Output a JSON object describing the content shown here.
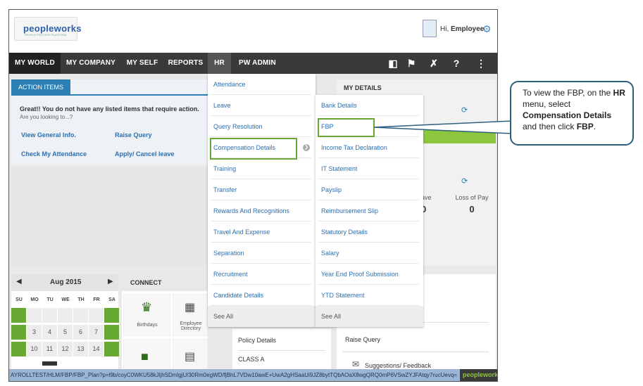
{
  "header": {
    "logo_word": "peopleworks",
    "logo_tagline": "PEOPLE PROCESS PLATFORM",
    "greeting_prefix": "Hi, ",
    "greeting_name": "Employee"
  },
  "nav": {
    "items": [
      "MY WORLD",
      "MY COMPANY",
      "MY SELF",
      "REPORTS",
      "HR",
      "PW ADMIN"
    ],
    "icons": [
      "book-icon",
      "flag-icon",
      "tools-icon",
      "help-icon",
      "sitemap-icon"
    ]
  },
  "action_items": {
    "tab_label": "ACTION ITEMS",
    "message": "Great!! You do not have any listed items that require action.",
    "sub": "Are you looking to...?",
    "links": [
      "View General Info.",
      "Raise Query",
      "Check My Attendance",
      "Apply/ Cancel leave"
    ]
  },
  "my_details": {
    "title": "MY DETAILS",
    "leave_label": "ave",
    "lop_label": "Loss of Pay",
    "lop_value": "0",
    "leave_value": "0"
  },
  "calendar": {
    "month": "Aug 2015",
    "days_of_week": [
      "SU",
      "MO",
      "TU",
      "WE",
      "TH",
      "FR",
      "SA"
    ],
    "rows": [
      [
        "",
        "",
        "",
        "",
        "",
        "",
        ""
      ],
      [
        "",
        "3",
        "4",
        "5",
        "6",
        "7",
        ""
      ],
      [
        "",
        "10",
        "11",
        "12",
        "13",
        "14",
        ""
      ]
    ]
  },
  "connect": {
    "title": "CONNECT",
    "tiles": [
      "Birthdays",
      "Employee Directory"
    ]
  },
  "middle_list": {
    "items": [
      "Policy Details",
      "CLASS A"
    ]
  },
  "right_list": {
    "items": [
      "Raise Query",
      "Suggestions/ Feedback"
    ]
  },
  "hr_menu": {
    "col1": [
      "Attendance",
      "Leave",
      "Query Resolution",
      "Compensation Details",
      "Training",
      "Transfer",
      "Rewards And Recognitions",
      "Travel And Expense",
      "Separation",
      "Recruitment",
      "Candidate Details"
    ],
    "col2": [
      "Bank Details",
      "FBP",
      "Income Tax Declaration",
      "IT Statement",
      "Payslip",
      "Reimbursement Slip",
      "Statutory Details",
      "Salary",
      "Year End Proof Submission",
      "YTD Statement"
    ],
    "see_all": "See All"
  },
  "status_bar": {
    "url": "AYROLLTEST/HLM/FBP/FBP_Plan?p=l9b/coyC0WKU58kJljhSDmlgjU/30Rm0egWD/fjBhL7VDw10awE+UwA2gHSaaUi9JZ8bytTQbAOaX8wgQRQ0mP6VSwZYJFAtqy7rucUevq="
  },
  "callout": {
    "line1": "To view the FBP, on the ",
    "hr": "HR",
    "line2": " menu, select ",
    "comp": "Compensation Details",
    "line3": " and then click ",
    "fbp": "FBP",
    "end": "."
  },
  "colors": {
    "nav_bg": "#3a3a3a",
    "accent_blue": "#2b7fb2",
    "highlight_green": "#6aa834",
    "link_blue": "#2b6fb2"
  }
}
